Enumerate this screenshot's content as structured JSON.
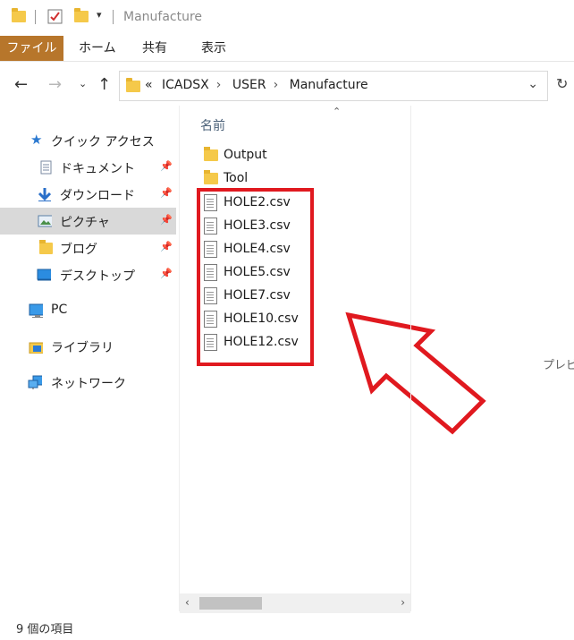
{
  "window": {
    "title": "Manufacture"
  },
  "ribbon": {
    "tabs": [
      {
        "label": "ファイル"
      },
      {
        "label": "ホーム"
      },
      {
        "label": "共有"
      },
      {
        "label": "表示"
      }
    ]
  },
  "address": {
    "overflow": "«",
    "crumbs": [
      "ICADSX",
      "USER",
      "Manufacture"
    ]
  },
  "sidebar": {
    "items": [
      {
        "label": "クイック アクセス",
        "icon": "star-icon"
      },
      {
        "label": "ドキュメント",
        "icon": "document-icon",
        "pinned": true
      },
      {
        "label": "ダウンロード",
        "icon": "download-arrow-icon",
        "pinned": true
      },
      {
        "label": "ピクチャ",
        "icon": "pictures-icon",
        "pinned": true,
        "selected": true
      },
      {
        "label": "ブログ",
        "icon": "folder-icon",
        "pinned": true
      },
      {
        "label": "デスクトップ",
        "icon": "desktop-icon",
        "pinned": true
      },
      {
        "label": "PC",
        "icon": "computer-icon"
      },
      {
        "label": "ライブラリ",
        "icon": "library-icon"
      },
      {
        "label": "ネットワーク",
        "icon": "network-icon"
      }
    ]
  },
  "content": {
    "column_header": "名前",
    "folders": [
      {
        "name": "Output"
      },
      {
        "name": "Tool"
      }
    ],
    "files": [
      {
        "name": "HOLE2.csv"
      },
      {
        "name": "HOLE3.csv"
      },
      {
        "name": "HOLE4.csv"
      },
      {
        "name": "HOLE5.csv"
      },
      {
        "name": "HOLE7.csv"
      },
      {
        "name": "HOLE10.csv"
      },
      {
        "name": "HOLE12.csv"
      }
    ]
  },
  "preview": {
    "text": "プレビ"
  },
  "status": {
    "text": "9 個の項目"
  },
  "colors": {
    "file_tab": "#b7762b",
    "highlight": "#e0191f",
    "selected_nav": "#d9d9d9"
  }
}
